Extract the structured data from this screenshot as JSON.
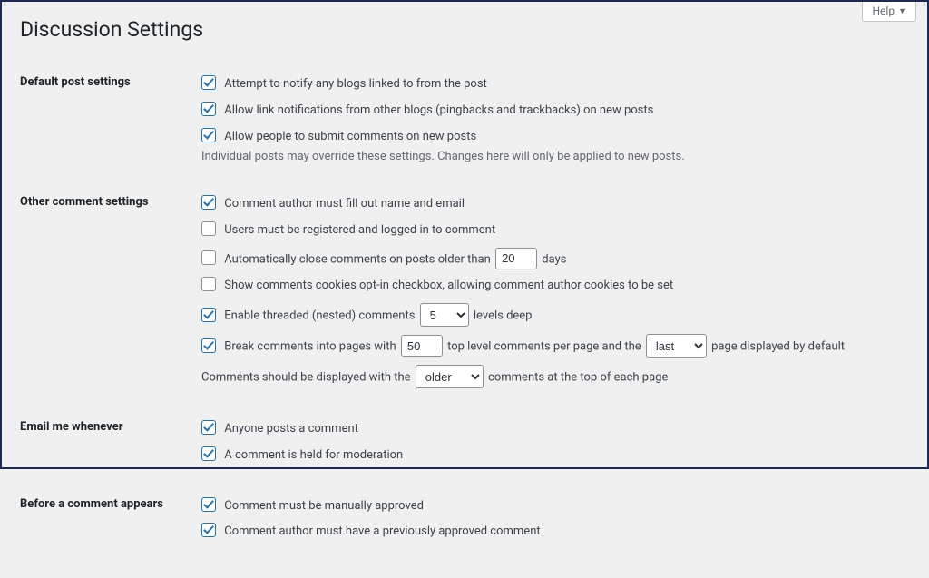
{
  "header": {
    "help": "Help"
  },
  "title": "Discussion Settings",
  "sections": {
    "default_post": {
      "heading": "Default post settings",
      "notify": "Attempt to notify any blogs linked to from the post",
      "pingback": "Allow link notifications from other blogs (pingbacks and trackbacks) on new posts",
      "allow_comments": "Allow people to submit comments on new posts",
      "note": "Individual posts may override these settings. Changes here will only be applied to new posts."
    },
    "other": {
      "heading": "Other comment settings",
      "name_email": "Comment author must fill out name and email",
      "registered": "Users must be registered and logged in to comment",
      "autoclose_pre": "Automatically close comments on posts older than",
      "autoclose_days_value": "20",
      "autoclose_post": "days",
      "cookies": "Show comments cookies opt-in checkbox, allowing comment author cookies to be set",
      "threaded_pre": "Enable threaded (nested) comments",
      "threaded_value": "5",
      "threaded_post": "levels deep",
      "paginate_pre": "Break comments into pages with",
      "paginate_perpage_value": "50",
      "paginate_mid": "top level comments per page and the",
      "paginate_default_value": "last",
      "paginate_post": "page displayed by default",
      "order_pre": "Comments should be displayed with the",
      "order_value": "older",
      "order_post": "comments at the top of each page"
    },
    "email_me": {
      "heading": "Email me whenever",
      "anyone": "Anyone posts a comment",
      "moderation": "A comment is held for moderation"
    },
    "before": {
      "heading": "Before a comment appears",
      "manual": "Comment must be manually approved",
      "prev_approved": "Comment author must have a previously approved comment"
    }
  }
}
